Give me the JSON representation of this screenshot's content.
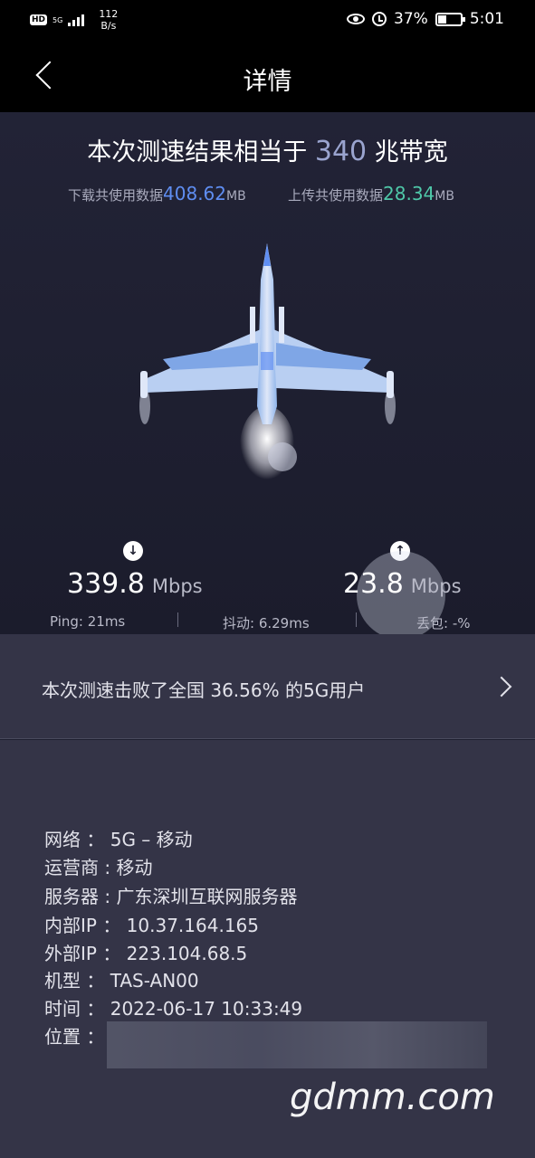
{
  "status_bar": {
    "hd": "HD",
    "net_type": "5G",
    "net_speed_value": "112",
    "net_speed_unit": "B/s",
    "battery": "37%",
    "time": "5:01"
  },
  "header": {
    "title": "详情"
  },
  "result": {
    "headline_prefix": "本次测速结果相当于 ",
    "bandwidth": "340",
    "headline_suffix": " 兆带宽",
    "download_data_label": "下载共使用数据",
    "download_data_value": "408.62",
    "download_data_unit": "MB",
    "upload_data_label": "上传共使用数据",
    "upload_data_value": "28.34",
    "upload_data_unit": "MB",
    "download_speed": "339.8",
    "upload_speed": "23.8",
    "speed_unit": "Mbps",
    "ping": "Ping:  21ms",
    "jitter": "抖动:  6.29ms",
    "loss": "丢包:  -%"
  },
  "rank": {
    "text": "本次测速击败了全国 36.56% 的5G用户"
  },
  "info": {
    "network": "网络 ： 5G – 移动",
    "carrier": "运营商 : 移动",
    "server": "服务器 : 广东深圳互联网服务器",
    "internal_ip": "内部IP ： 10.37.164.165",
    "external_ip": "外部IP ： 223.104.68.5",
    "model": "机型 ： TAS-AN00",
    "time": "时间 ： 2022-06-17 10:33:49",
    "location_label": "位置 ："
  },
  "watermark": "gdmm.com"
}
